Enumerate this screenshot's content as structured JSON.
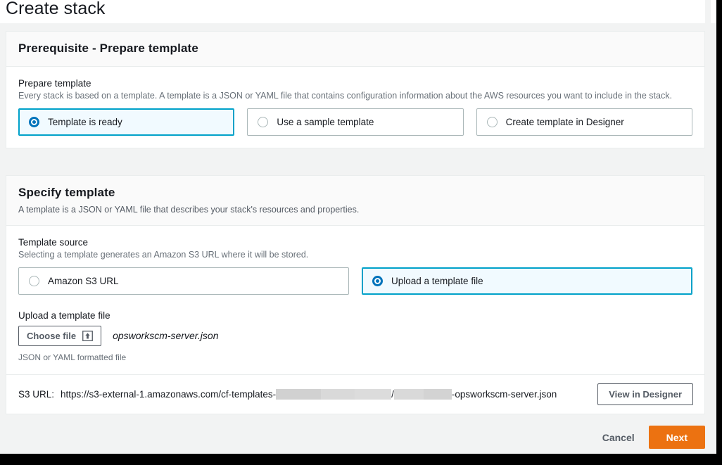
{
  "page": {
    "title": "Create stack"
  },
  "prerequisite_card": {
    "header": "Prerequisite - Prepare template",
    "prepare_template": {
      "label": "Prepare template",
      "description": "Every stack is based on a template. A template is a JSON or YAML file that contains configuration information about the AWS resources you want to include in the stack.",
      "options": [
        {
          "label": "Template is ready",
          "selected": true
        },
        {
          "label": "Use a sample template",
          "selected": false
        },
        {
          "label": "Create template in Designer",
          "selected": false
        }
      ]
    }
  },
  "specify_card": {
    "header": "Specify template",
    "description": "A template is a JSON or YAML file that describes your stack's resources and properties.",
    "template_source": {
      "label": "Template source",
      "description": "Selecting a template generates an Amazon S3 URL where it will be stored.",
      "options": [
        {
          "label": "Amazon S3 URL",
          "selected": false
        },
        {
          "label": "Upload a template file",
          "selected": true
        }
      ]
    },
    "upload": {
      "label": "Upload a template file",
      "choose_file_button": "Choose file",
      "upload_icon": "upload-icon",
      "file_name": "opsworkscm-server.json",
      "hint": "JSON or YAML formatted file"
    },
    "s3_url": {
      "label": "S3 URL:",
      "prefix": "https://s3-external-1.amazonaws.com/cf-templates-",
      "separator": "/",
      "suffix": "-opsworkscm-server.json",
      "redacted": true,
      "view_designer_button": "View in Designer"
    }
  },
  "footer": {
    "cancel_label": "Cancel",
    "next_label": "Next"
  },
  "colors": {
    "accent_orange": "#ec7211",
    "selected_blue": "#0073bb",
    "selected_border": "#00a1c9",
    "selected_fill": "#f1faff",
    "page_background": "#f2f3f3",
    "redaction_gray": "#d5d5d5"
  }
}
